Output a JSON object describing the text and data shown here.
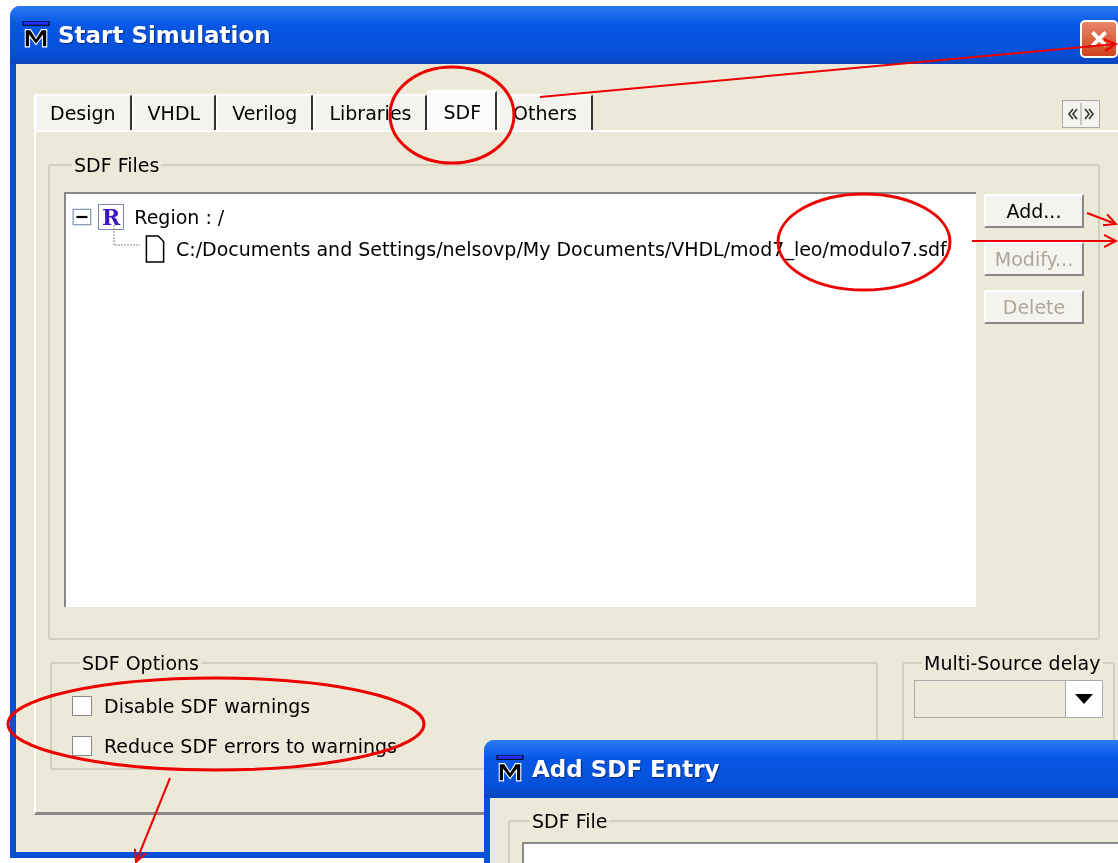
{
  "window": {
    "title": "Start Simulation"
  },
  "tabs": [
    {
      "label": "Design",
      "selected": false
    },
    {
      "label": "VHDL",
      "selected": false
    },
    {
      "label": "Verilog",
      "selected": false
    },
    {
      "label": "Libraries",
      "selected": false
    },
    {
      "label": "SDF",
      "selected": true
    },
    {
      "label": "Others",
      "selected": false
    }
  ],
  "sdf_files": {
    "title": "SDF Files",
    "tree": [
      {
        "icon_letter": "R",
        "label": "Region : /",
        "expanded": true,
        "children": [
          {
            "label": "C:/Documents and Settings/nelsovp/My Documents/VHDL/mod7_leo/modulo7.sdf"
          }
        ]
      }
    ],
    "buttons": [
      {
        "label": "Add...",
        "disabled": false
      },
      {
        "label": "Modify...",
        "disabled": true
      },
      {
        "label": "Delete",
        "disabled": true
      }
    ]
  },
  "sdf_options": {
    "title": "SDF Options",
    "checkboxes": [
      {
        "label": "Disable SDF warnings",
        "checked": false
      },
      {
        "label": "Reduce SDF errors to warnings",
        "checked": false
      }
    ]
  },
  "multi_source_delay": {
    "title": "Multi-Source delay"
  },
  "dialog": {
    "title": "Add SDF Entry",
    "group_title": "SDF File"
  }
}
